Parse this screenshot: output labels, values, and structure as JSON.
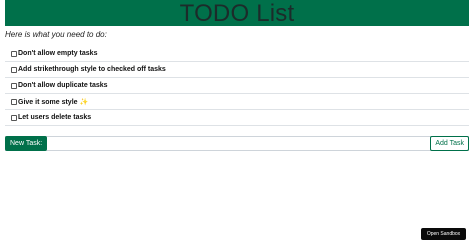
{
  "header": {
    "title": "TODO List"
  },
  "intro": {
    "text": "Here is what you need to do:"
  },
  "tasks": [
    {
      "label": "Don't allow empty tasks",
      "checked": false
    },
    {
      "label": "Add strikethrough style to checked off tasks",
      "checked": false
    },
    {
      "label": "Don't allow duplicate tasks",
      "checked": false
    },
    {
      "label": "Give it some style ✨",
      "checked": false
    },
    {
      "label": "Let users delete tasks",
      "checked": false
    }
  ],
  "actions": {
    "new_task_label": "New Task:",
    "new_task_value": "",
    "add_task_label": "Add Task"
  },
  "sandbox": {
    "label": "Open Sandbox"
  },
  "colors": {
    "accent": "#00704a",
    "header_text": "#1c2b2a",
    "sandbox_bg": "#0a0a0a"
  }
}
